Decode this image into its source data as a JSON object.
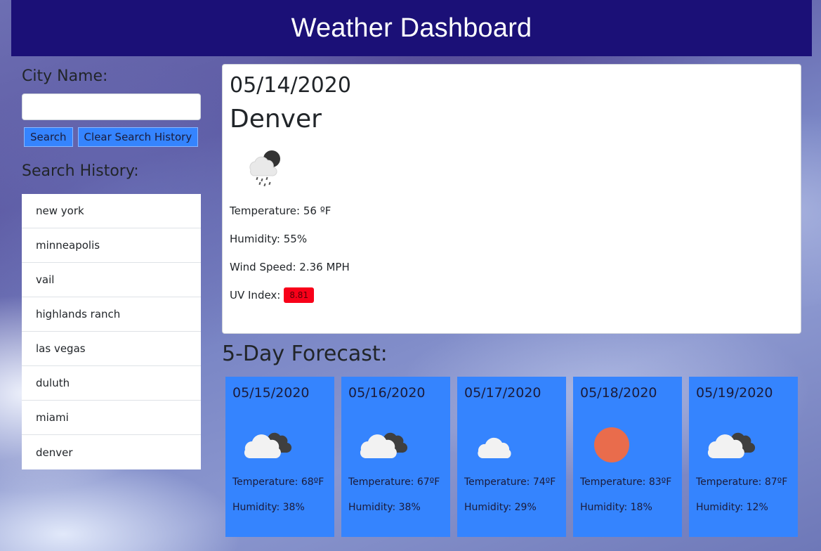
{
  "header": {
    "title": "Weather Dashboard"
  },
  "sidebar": {
    "city_label": "City Name:",
    "city_input_value": "",
    "search_button": "Search",
    "clear_button": "Clear Search History",
    "history_label": "Search History:",
    "history": [
      "new york",
      "minneapolis",
      "vail",
      "highlands ranch",
      "las vegas",
      "duluth",
      "miami",
      "denver"
    ]
  },
  "current": {
    "date": "05/14/2020",
    "city": "Denver",
    "icon": "rain-night-icon",
    "temperature": "Temperature: 56 ºF",
    "humidity": "Humidity: 55%",
    "wind": "Wind Speed: 2.36 MPH",
    "uv_label": "UV Index:",
    "uv_value": "8.81",
    "uv_color": "#f80019"
  },
  "forecast": {
    "title": "5-Day Forecast:",
    "days": [
      {
        "date": "05/15/2020",
        "icon": "broken-clouds-icon",
        "temp": "Temperature: 68ºF",
        "humidity": "Humidity: 38%"
      },
      {
        "date": "05/16/2020",
        "icon": "broken-clouds-icon",
        "temp": "Temperature: 67ºF",
        "humidity": "Humidity: 38%"
      },
      {
        "date": "05/17/2020",
        "icon": "cloud-icon",
        "temp": "Temperature: 74ºF",
        "humidity": "Humidity: 29%"
      },
      {
        "date": "05/18/2020",
        "icon": "sun-icon",
        "temp": "Temperature: 83ºF",
        "humidity": "Humidity: 18%"
      },
      {
        "date": "05/19/2020",
        "icon": "broken-clouds-icon",
        "temp": "Temperature: 87ºF",
        "humidity": "Humidity: 12%"
      }
    ]
  },
  "colors": {
    "header": "#1b1077",
    "accent": "#3584fe",
    "uv": "#f80019"
  }
}
